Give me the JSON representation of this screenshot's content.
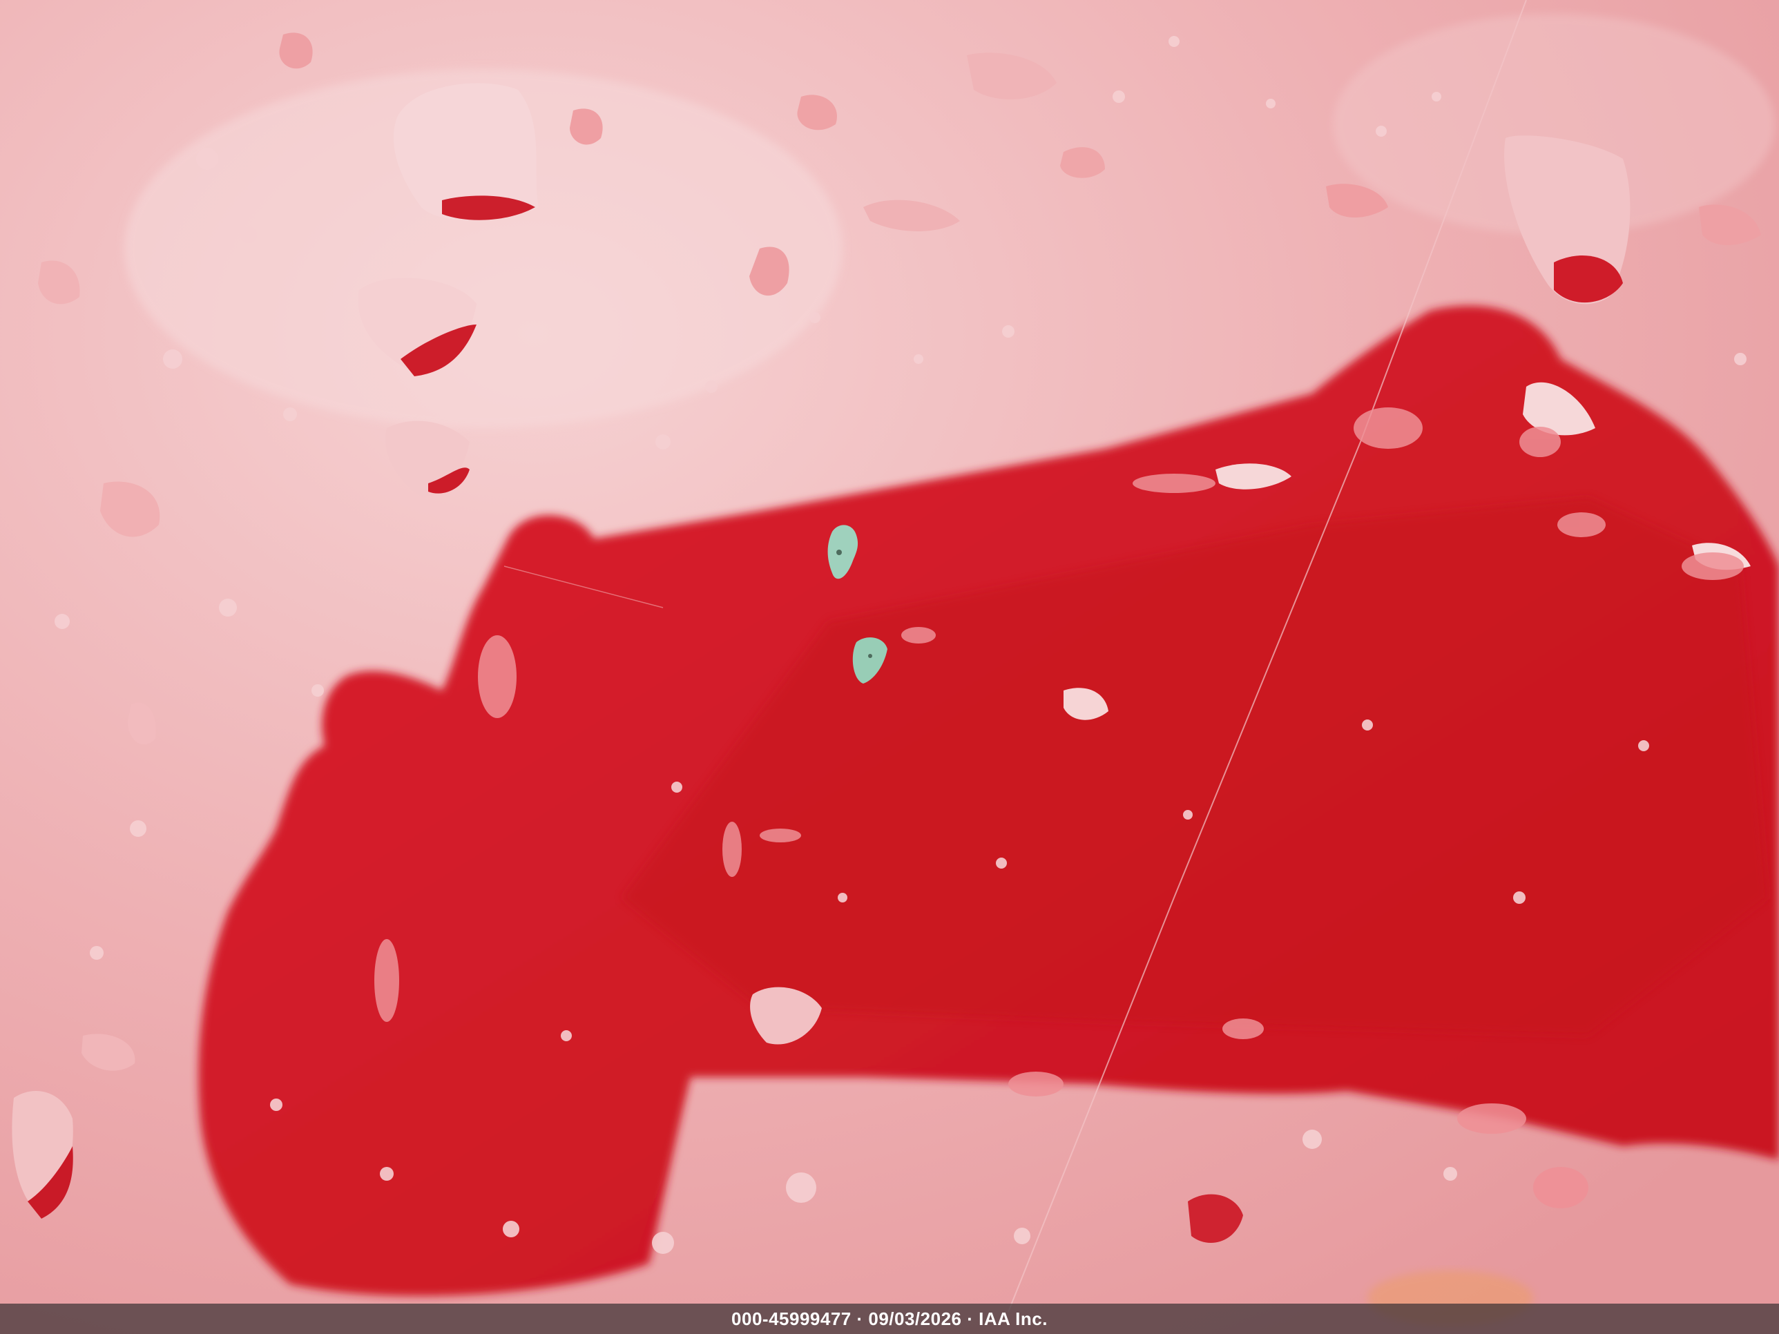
{
  "image": {
    "subject": "wet red car panel with raindrops and shadow",
    "colors": {
      "paint_light": "#eeb3b6",
      "paint_pink": "#e79497",
      "paint_red": "#d71d2b",
      "paint_deep": "#c4131f",
      "droplet_highlight": "#fbe7e8",
      "droplet_edge": "#c81a27",
      "chip": "#9ccfb9",
      "caption_bg": "#3c3234",
      "caption_text": "#ffffff"
    }
  },
  "caption": {
    "text": "000-45999477 · 09/03/2026 · IAA Inc."
  }
}
